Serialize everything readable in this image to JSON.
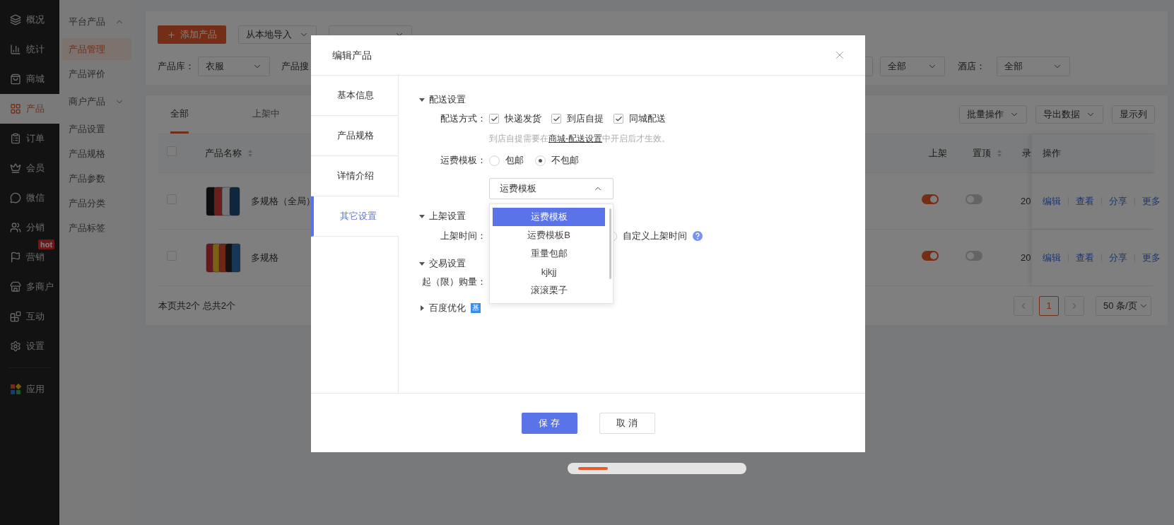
{
  "nav": {
    "items": [
      {
        "label": "概况",
        "selected": false
      },
      {
        "label": "统计",
        "selected": false
      },
      {
        "label": "商城",
        "selected": false
      },
      {
        "label": "产品",
        "selected": true
      },
      {
        "label": "订单",
        "selected": false
      },
      {
        "label": "会员",
        "selected": false
      },
      {
        "label": "微信",
        "selected": false
      },
      {
        "label": "分销",
        "selected": false
      },
      {
        "label": "营销",
        "selected": false,
        "badge": "hot"
      },
      {
        "label": "多商户",
        "selected": false
      },
      {
        "label": "互动",
        "selected": false
      },
      {
        "label": "设置",
        "selected": false
      }
    ],
    "footer_item": {
      "label": "应用",
      "selected": false
    }
  },
  "subnav": [
    {
      "kind": "group",
      "label": "平台产品",
      "expanded": true
    },
    {
      "kind": "item",
      "label": "产品管理",
      "selected": true
    },
    {
      "kind": "item",
      "label": "产品评价",
      "selected": false
    },
    {
      "kind": "group",
      "label": "商户产品",
      "expanded": false
    },
    {
      "kind": "item",
      "label": "产品设置",
      "selected": false
    },
    {
      "kind": "item",
      "label": "产品规格",
      "selected": false
    },
    {
      "kind": "item",
      "label": "产品参数",
      "selected": false
    },
    {
      "kind": "item",
      "label": "产品分类",
      "selected": false
    },
    {
      "kind": "item",
      "label": "产品标签",
      "selected": false
    }
  ],
  "toolbar": {
    "add_button": "添加产品",
    "import_local": "从本地导入"
  },
  "filters": {
    "library_label": "产品库：",
    "library_value": "衣服",
    "search_label": "产品搜",
    "status_value": "全部",
    "hotel_label": "酒店：",
    "hotel_value": "全部"
  },
  "tabs": [
    {
      "label": "全部",
      "selected": true
    },
    {
      "label": "上架中",
      "selected": false
    }
  ],
  "actions": [
    {
      "label": "批量操作",
      "dropdown": true
    },
    {
      "label": "导出数据",
      "dropdown": true
    },
    {
      "label": "显示列",
      "dropdown": false
    }
  ],
  "table": {
    "select_all_checked": false,
    "columns": {
      "name": "产品名称",
      "on_shelf": "上架",
      "pinned": "置顶",
      "column_7": "录",
      "actions": "操作"
    },
    "rows": [
      {
        "checked": false,
        "name": "多规格（全局）",
        "on_shelf": true,
        "pinned": false,
        "column_7": "20",
        "actions": [
          "编辑",
          "查看",
          "分享",
          "更多"
        ]
      },
      {
        "checked": false,
        "name": "多规格",
        "on_shelf": true,
        "pinned": false,
        "column_7": "20",
        "actions": [
          "编辑",
          "查看",
          "分享",
          "更多"
        ]
      }
    ],
    "summary": "本页共2个 总共2个"
  },
  "pagination": {
    "pages": [
      {
        "label": "1",
        "selected": true
      }
    ],
    "page_size": "50 条/页"
  },
  "modal": {
    "title": "编辑产品",
    "tabs": [
      {
        "label": "基本信息",
        "selected": false
      },
      {
        "label": "产品规格",
        "selected": false
      },
      {
        "label": "详情介绍",
        "selected": false
      },
      {
        "label": "其它设置",
        "selected": true
      }
    ],
    "sections": [
      {
        "title": "配送设置",
        "expanded": true,
        "rows": [
          {
            "kind": "checkboxes",
            "label": "配送方式：",
            "options": [
              {
                "label": "快递发货",
                "checked": true
              },
              {
                "label": "到店自提",
                "checked": true
              },
              {
                "label": "同城配送",
                "checked": true
              }
            ]
          },
          {
            "kind": "hint",
            "before": "到店自提需要在",
            "link": "商城-配送设置",
            "after": "中开启后才生效。"
          },
          {
            "kind": "radios",
            "label": "运费模板：",
            "options": [
              {
                "label": "包邮",
                "selected": false
              },
              {
                "label": "不包邮",
                "selected": true
              }
            ]
          },
          {
            "kind": "select",
            "value": "运费模板",
            "open": true,
            "options": [
              {
                "label": "运费模板",
                "selected": true
              },
              {
                "label": "运费模板B",
                "selected": false
              },
              {
                "label": "重量包邮",
                "selected": false
              },
              {
                "label": "kjkjj",
                "selected": false
              },
              {
                "label": "滚滚栗子",
                "selected": false
              }
            ]
          }
        ]
      },
      {
        "title": "上架设置",
        "expanded": true,
        "rows": [
          {
            "kind": "radios",
            "label": "上架时间：",
            "help": true,
            "options": [
              {
                "label": "自定义上架时间",
                "selected": false
              }
            ]
          }
        ]
      },
      {
        "title": "交易设置",
        "expanded": true,
        "rows": [
          {
            "kind": "label",
            "label": "起（限）购量："
          }
        ]
      },
      {
        "title": "百度优化",
        "expanded": false,
        "badge": "基"
      }
    ],
    "buttons": [
      {
        "label": "保 存",
        "kind": "primary"
      },
      {
        "label": "取 消",
        "kind": "default"
      }
    ]
  }
}
